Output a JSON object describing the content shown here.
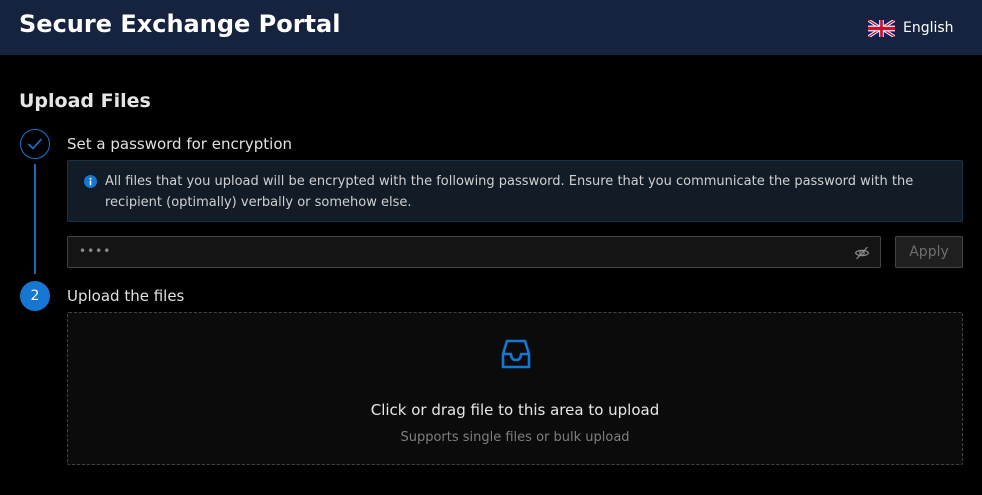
{
  "header": {
    "app_title": "Secure Exchange Portal",
    "language": "English",
    "language_flag_icon": "uk-flag-icon"
  },
  "page": {
    "title": "Upload Files"
  },
  "steps": [
    {
      "status": "finished",
      "icon": "check-icon",
      "title": "Set a password for encryption",
      "info_icon": "info-circle-icon",
      "info_text": "All files that you upload will be encrypted with the following password. Ensure that you communicate the password with the recipient (optimally) verbally or somehow else.",
      "password_value": "••••",
      "password_visibility_icon": "eye-invisible-icon",
      "apply_label": "Apply",
      "apply_disabled": true
    },
    {
      "status": "active",
      "number": "2",
      "title": "Upload the files",
      "upload_icon": "inbox-icon",
      "upload_text": "Click or drag file to this area to upload",
      "upload_hint": "Supports single files or bulk upload"
    }
  ],
  "colors": {
    "header_bg": "#15233f",
    "accent": "#1677d2",
    "page_bg": "#000000",
    "info_bg": "#111c26"
  }
}
